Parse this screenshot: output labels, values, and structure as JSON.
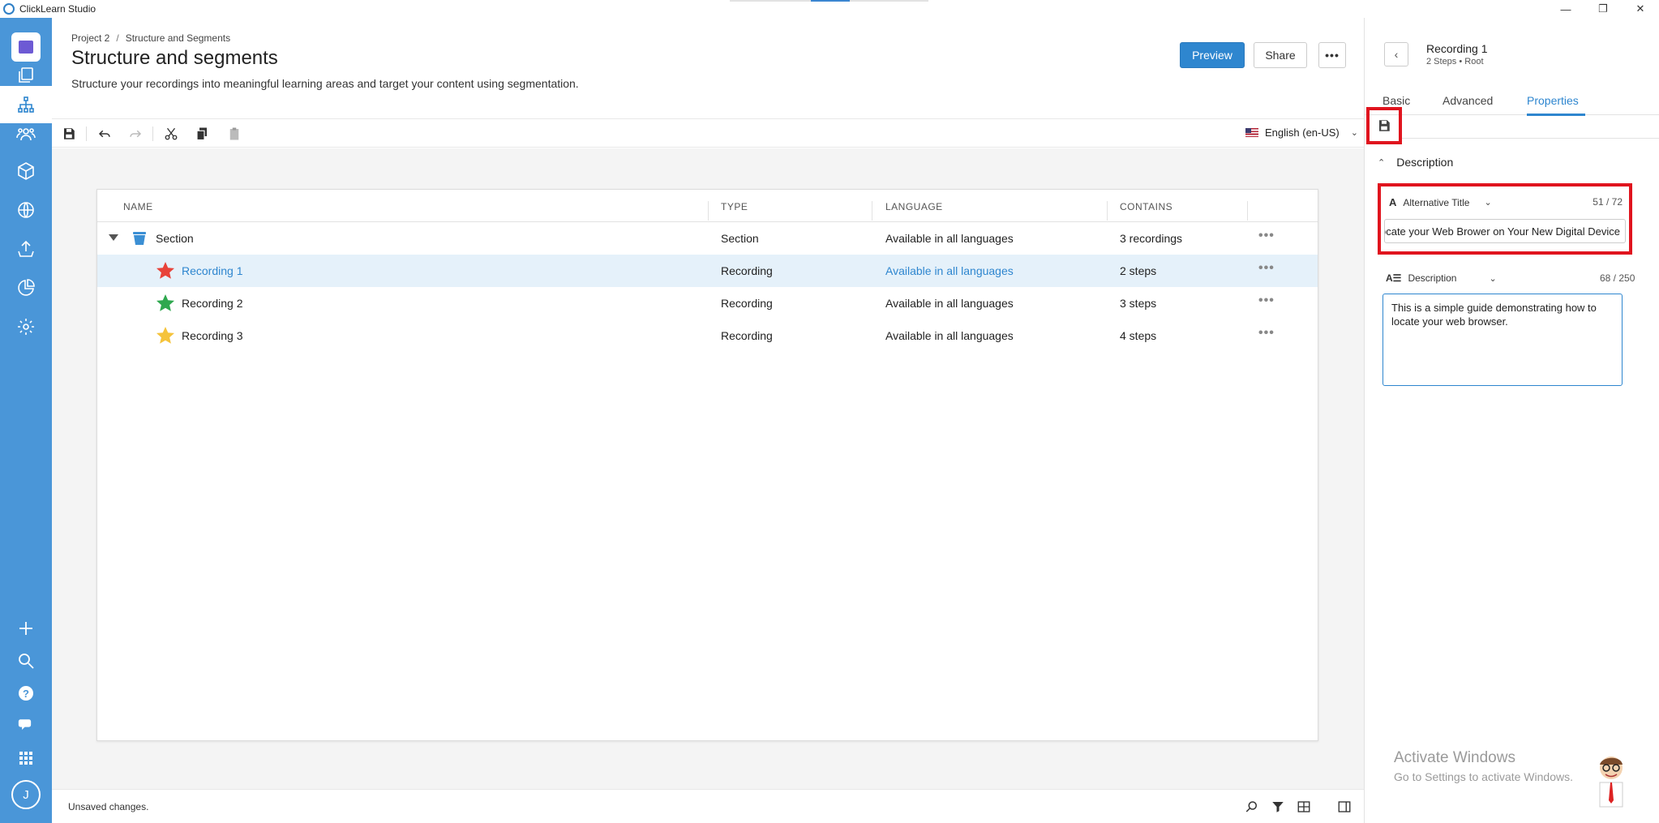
{
  "window": {
    "title": "ClickLearn Studio",
    "minimize": "—",
    "restore": "❐",
    "close": "✕"
  },
  "rail": {
    "avatar_initial": "J",
    "icons": [
      "recordings-icon",
      "structure-icon",
      "users-icon",
      "package-icon",
      "globe-icon",
      "publish-icon",
      "analytics-icon",
      "settings-icon",
      "add-icon",
      "search-icon",
      "help-icon",
      "chat-icon",
      "apps-grid-icon"
    ]
  },
  "header": {
    "breadcrumb": [
      "Project 2",
      "Structure and Segments"
    ],
    "breadcrumb_sep": "/",
    "title": "Structure and segments",
    "subtitle": "Structure your recordings into meaningful learning areas and target your content using segmentation.",
    "preview_label": "Preview",
    "share_label": "Share",
    "more_label": "•••"
  },
  "toolbar": {
    "language": "English (en-US)",
    "language_chevron": "⌄"
  },
  "table": {
    "columns": {
      "name": "NAME",
      "type": "TYPE",
      "language": "LANGUAGE",
      "contains": "CONTAINS"
    },
    "more_label": "•••",
    "rows": [
      {
        "name": "Section",
        "type": "Section",
        "language": "Available in all languages",
        "contains": "3 recordings",
        "icon": "bucket-icon"
      },
      {
        "name": "Recording 1",
        "type": "Recording",
        "language": "Available in all languages",
        "contains": "2 steps",
        "icon": "star-icon",
        "color": "#e8433a"
      },
      {
        "name": "Recording 2",
        "type": "Recording",
        "language": "Available in all languages",
        "contains": "3 steps",
        "icon": "star-icon",
        "color": "#2fa84f"
      },
      {
        "name": "Recording 3",
        "type": "Recording",
        "language": "Available in all languages",
        "contains": "4 steps",
        "icon": "star-icon",
        "color": "#f5c33b"
      }
    ]
  },
  "statusbar": {
    "text": "Unsaved changes."
  },
  "panel": {
    "back_label": "‹",
    "title": "Recording 1",
    "meta": "2 Steps • Root",
    "tabs": [
      "Basic",
      "Advanced",
      "Properties"
    ],
    "active_tab": "Properties",
    "section_title": "Description",
    "section_chevron": "⌃",
    "alt_title": {
      "label": "Alternative Title",
      "icon_glyph": "A",
      "chevron": "⌄",
      "count": "51 / 72",
      "value": "Locate your Web Brower on Your New Digital Device"
    },
    "description": {
      "label": "Description",
      "icon_glyph": "A☰",
      "chevron": "⌄",
      "count": "68 / 250",
      "value": "This is a simple guide demonstrating how to locate your web browser."
    },
    "watermark_title": "Activate Windows",
    "watermark_sub": "Go to Settings to activate Windows."
  },
  "colors": {
    "rail": "#4a96d8",
    "accent": "#2e86cf",
    "highlight": "#e0141e",
    "selected_row": "#e5f1fa"
  }
}
